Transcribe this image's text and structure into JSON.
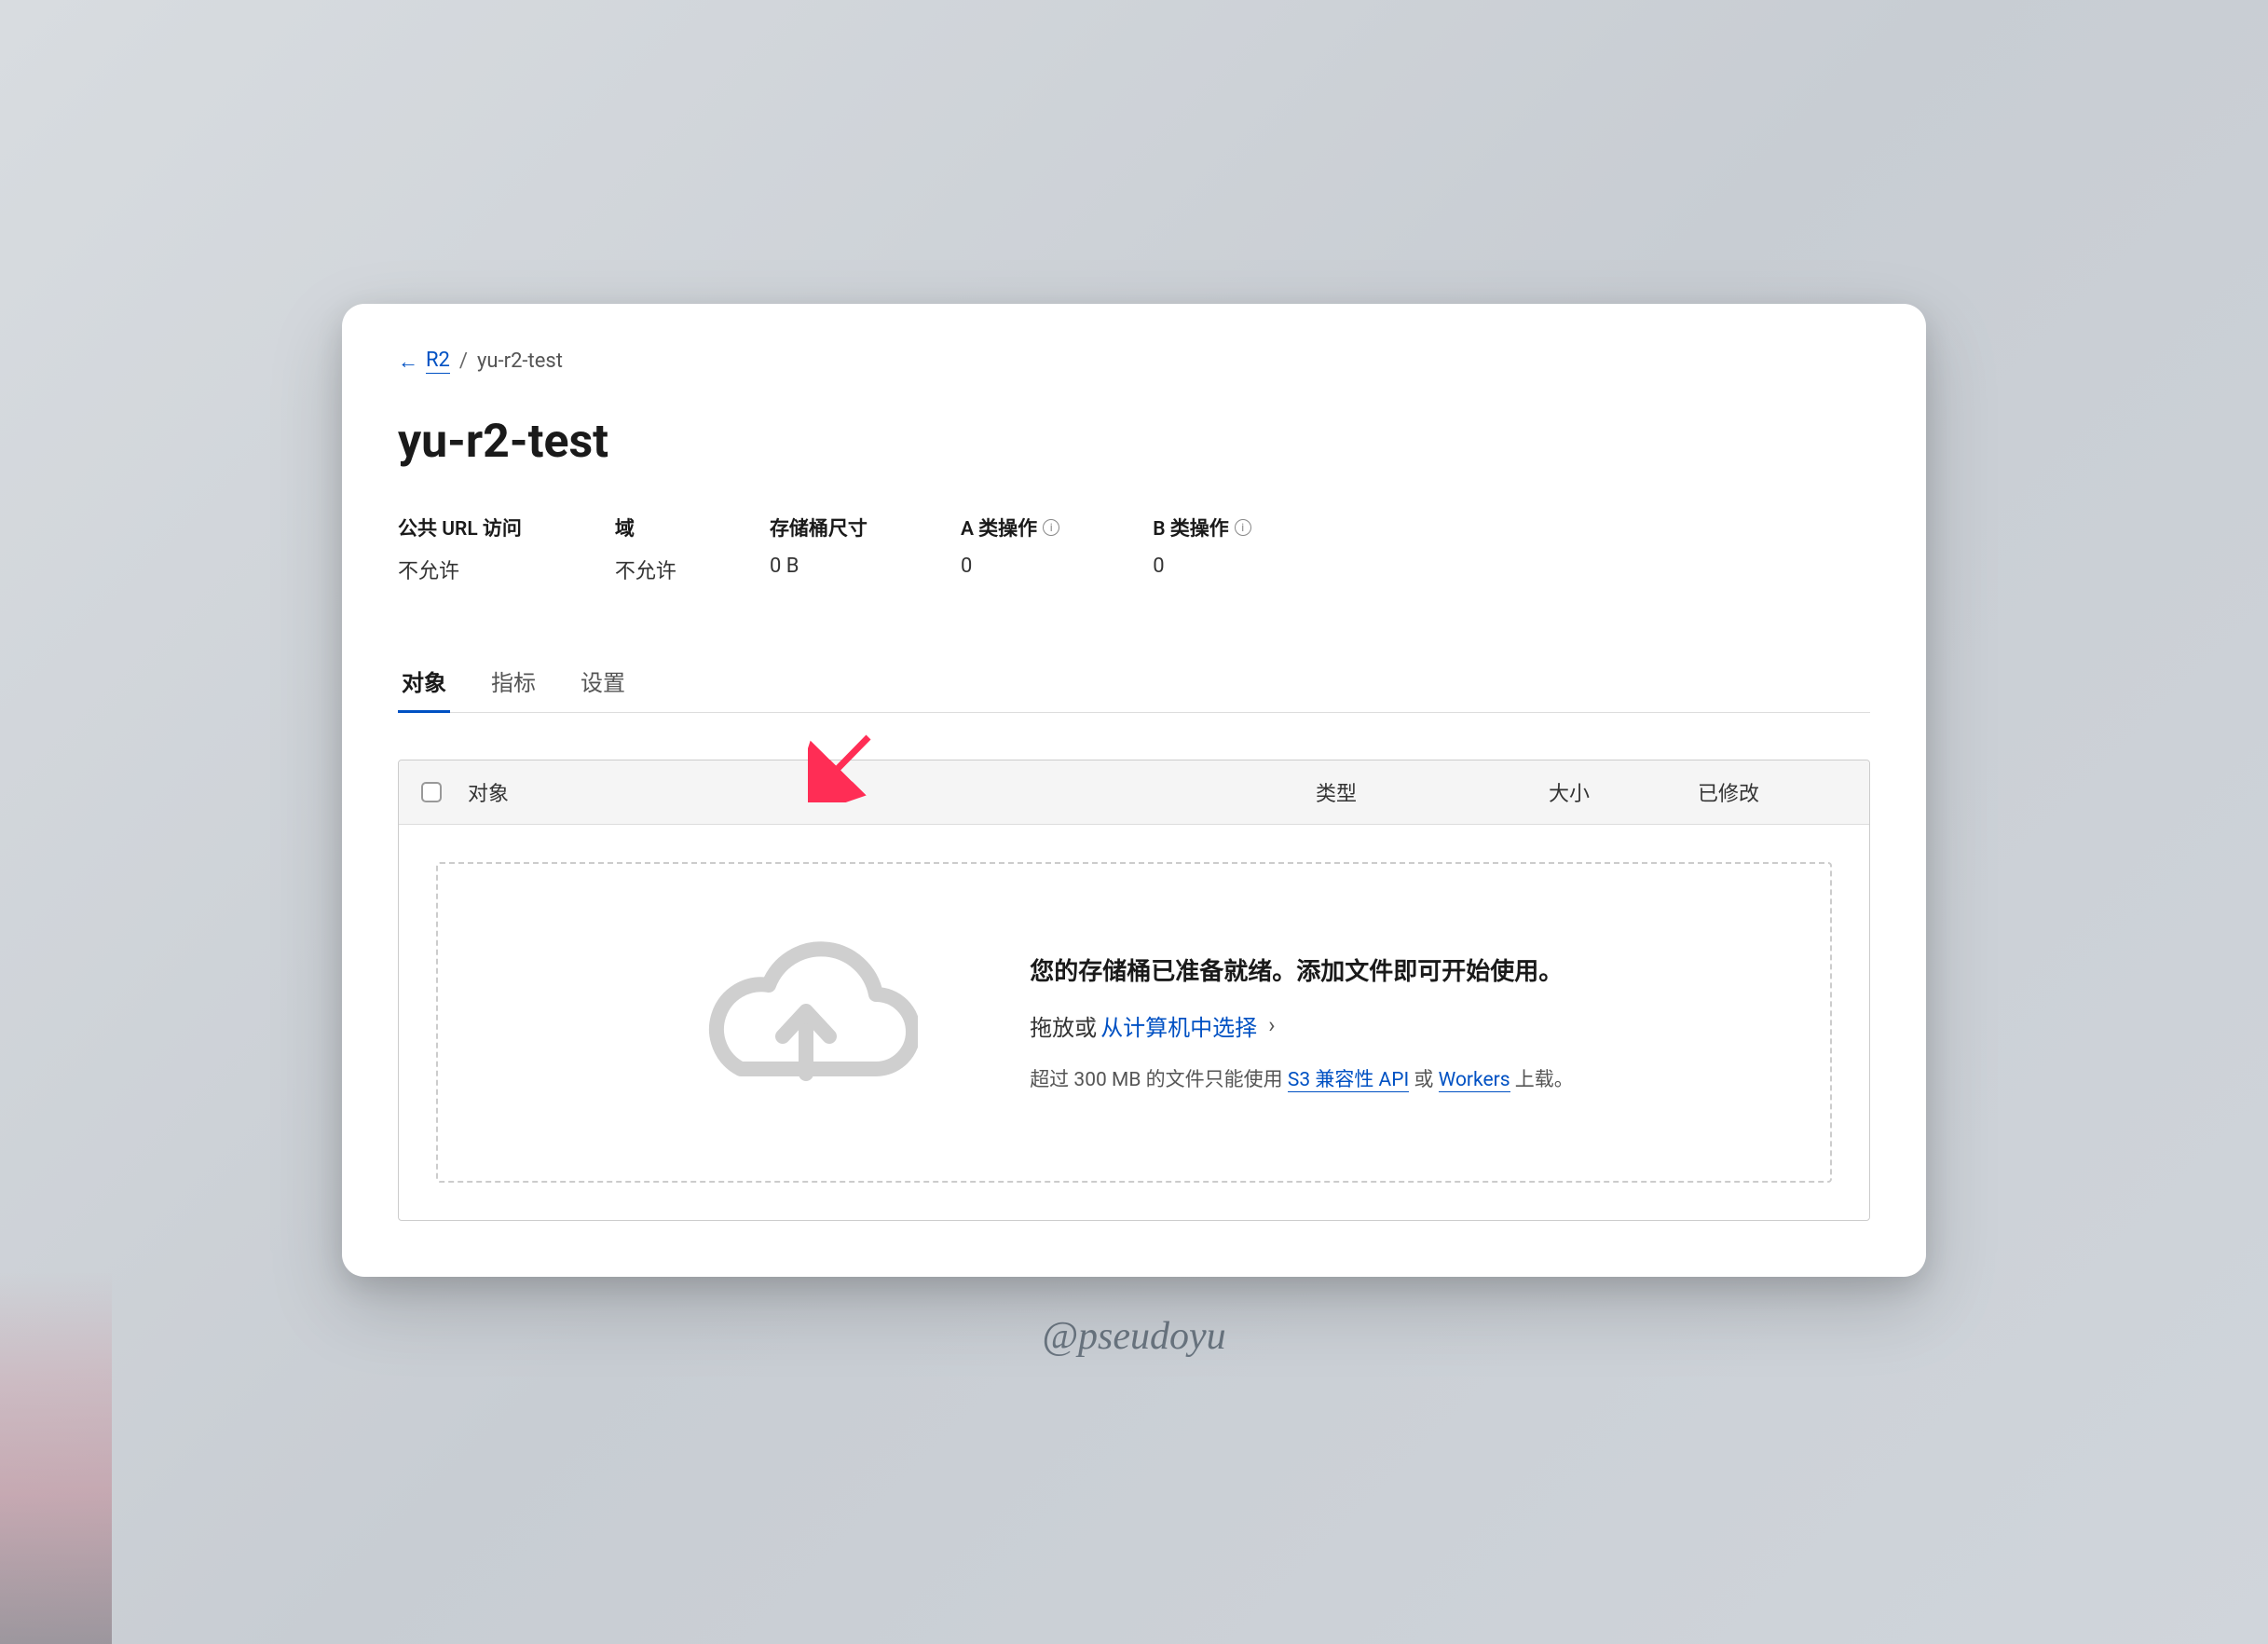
{
  "breadcrumb": {
    "back_label": "R2",
    "current": "yu-r2-test"
  },
  "page_title": "yu-r2-test",
  "stats": {
    "public_url": {
      "label": "公共 URL 访问",
      "value": "不允许"
    },
    "domain": {
      "label": "域",
      "value": "不允许"
    },
    "bucket_size": {
      "label": "存储桶尺寸",
      "value": "0 B"
    },
    "class_a": {
      "label": "A 类操作",
      "value": "0"
    },
    "class_b": {
      "label": "B 类操作",
      "value": "0"
    }
  },
  "tabs": {
    "objects": "对象",
    "metrics": "指标",
    "settings": "设置"
  },
  "table": {
    "headers": {
      "name": "对象",
      "type": "类型",
      "size": "大小",
      "modified": "已修改"
    }
  },
  "dropzone": {
    "title": "您的存储桶已准备就绪。添加文件即可开始使用。",
    "drag_prefix": "拖放或",
    "select_link": "从计算机中选择",
    "hint_prefix": "超过 300 MB 的文件只能使用 ",
    "hint_link1": "S3 兼容性 API",
    "hint_mid": " 或 ",
    "hint_link2": "Workers",
    "hint_suffix": " 上载。"
  },
  "watermark": "@pseudoyu"
}
